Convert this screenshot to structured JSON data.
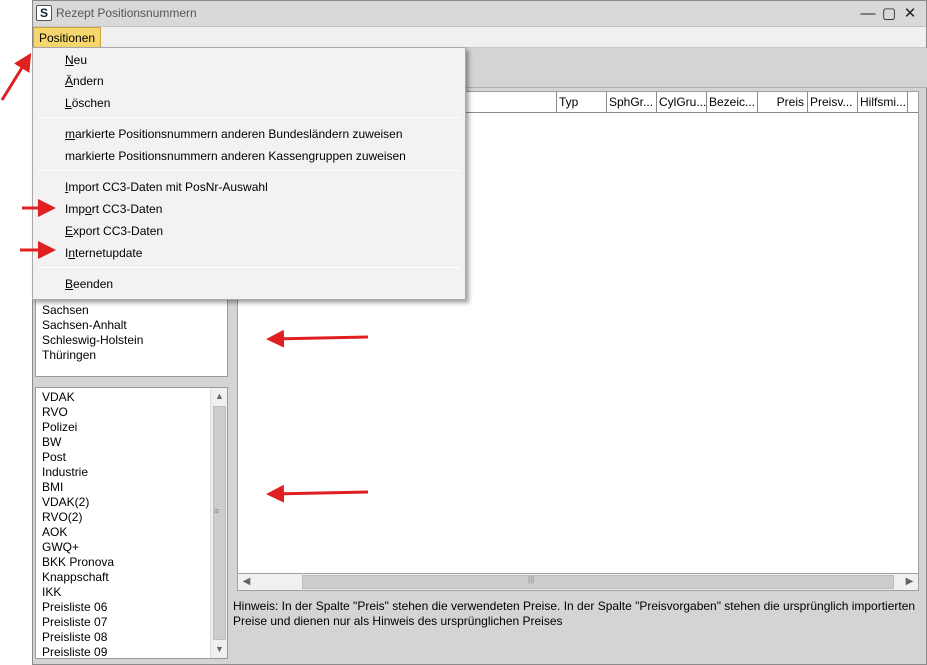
{
  "window": {
    "title": "Rezept Positionsnummern",
    "icon_glyph": "S"
  },
  "window_controls": {
    "minimize": "—",
    "maximize": "▢",
    "close": "✕"
  },
  "menu": {
    "positionen": "Positionen"
  },
  "dropdown": {
    "items": [
      {
        "mnemonic": "N",
        "rest": "eu"
      },
      {
        "mnemonic": "Ä",
        "rest": "ndern"
      },
      {
        "mnemonic": "L",
        "rest": "öschen"
      },
      {
        "mnemonic": "m",
        "rest": "arkierte Positionsnummern anderen Bundesländern zuweisen"
      },
      {
        "mnemonic": "",
        "rest": "markierte Positionsnummern anderen Kassengruppen zuweisen"
      },
      {
        "mnemonic": "I",
        "rest": "mport CC3-Daten mit PosNr-Auswahl"
      },
      {
        "prefix": "Imp",
        "mnemonic": "o",
        "rest": "rt CC3-Daten"
      },
      {
        "mnemonic": "E",
        "rest": "xport CC3-Daten"
      },
      {
        "prefix": "I",
        "mnemonic": "n",
        "rest": "ternetupdate"
      },
      {
        "mnemonic": "B",
        "rest": "eenden"
      }
    ]
  },
  "grid": {
    "columns": [
      "Typ",
      "SphGr...",
      "CylGru...",
      "Bezeic...",
      "Preis",
      "Preisv...",
      "Hilfsmi..."
    ]
  },
  "states_list": [
    "Sachsen",
    "Sachsen-Anhalt",
    "Schleswig-Holstein",
    "Thüringen"
  ],
  "kassen_list": [
    "VDAK",
    "RVO",
    "Polizei",
    "BW",
    "Post",
    "Industrie",
    "BMI",
    "VDAK(2)",
    "RVO(2)",
    "AOK",
    "GWQ+",
    "BKK Pronova",
    "Knappschaft",
    "IKK",
    "Preisliste 06",
    "Preisliste 07",
    "Preisliste 08",
    "Preisliste 09"
  ],
  "hint": "Hinweis: In der Spalte \"Preis\" stehen die verwendeten Preise. In der Spalte \"Preisvorgaben\" stehen die ursprünglich importierten Preise und dienen nur als Hinweis des ursprünglichen Preises",
  "colors": {
    "menu_highlight": "#f6d76e",
    "annotation_arrow": "#e02020"
  }
}
